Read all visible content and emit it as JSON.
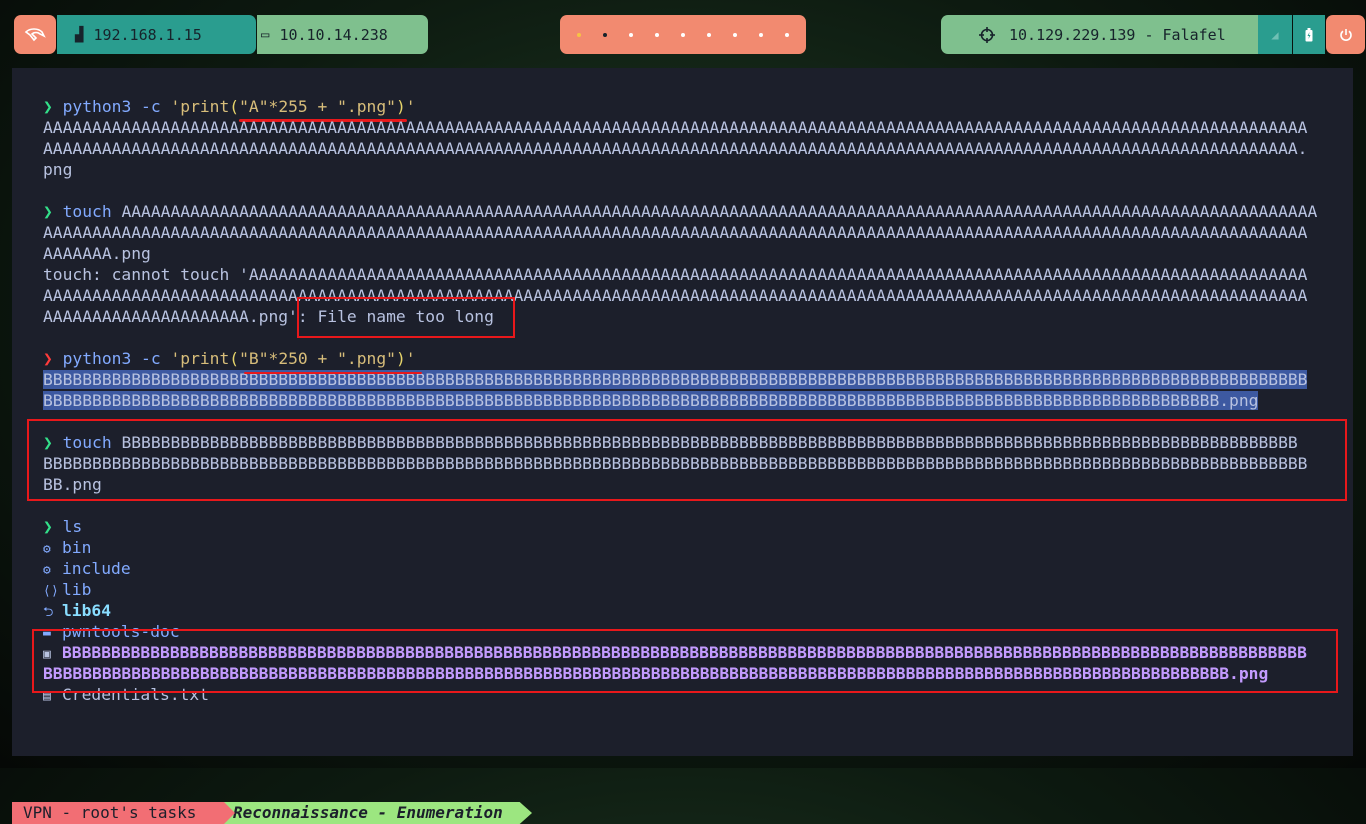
{
  "topbar": {
    "local_ip": "192.168.1.15",
    "vpn_ip": "10.10.14.238",
    "target": "10.129.229.139 - Falafel",
    "workspaces": [
      "urgent",
      "active",
      "",
      "",
      "",
      "",
      "",
      "",
      ""
    ]
  },
  "terminal": {
    "l1_prompt": "❯",
    "l1_cmd": "python3",
    "l1_flag": " -c ",
    "l1_str1": "'print",
    "l1_p1": "(",
    "l1_str2": "\"A\"*255 + \".png\"",
    "l1_p2": ")",
    "l1_str3": "'",
    "l2": "AAAAAAAAAAAAAAAAAAAAAAAAAAAAAAAAAAAAAAAAAAAAAAAAAAAAAAAAAAAAAAAAAAAAAAAAAAAAAAAAAAAAAAAAAAAAAAAAAAAAAAAAAAAAAAAAAAAAAAAAAAAAAAAAA",
    "l3": "AAAAAAAAAAAAAAAAAAAAAAAAAAAAAAAAAAAAAAAAAAAAAAAAAAAAAAAAAAAAAAAAAAAAAAAAAAAAAAAAAAAAAAAAAAAAAAAAAAAAAAAAAAAAAAAAAAAAAAAAAAAAAAAA.",
    "l4": "png",
    "l5_prompt": "❯",
    "l5_cmd": "touch",
    "l5_rest": " AAAAAAAAAAAAAAAAAAAAAAAAAAAAAAAAAAAAAAAAAAAAAAAAAAAAAAAAAAAAAAAAAAAAAAAAAAAAAAAAAAAAAAAAAAAAAAAAAAAAAAAAAAAAAAAAAAAAAAAAAA",
    "l6": "AAAAAAAAAAAAAAAAAAAAAAAAAAAAAAAAAAAAAAAAAAAAAAAAAAAAAAAAAAAAAAAAAAAAAAAAAAAAAAAAAAAAAAAAAAAAAAAAAAAAAAAAAAAAAAAAAAAAAAAAAAAAAAAAA",
    "l7": "AAAAAAA.png",
    "l8": "touch: cannot touch 'AAAAAAAAAAAAAAAAAAAAAAAAAAAAAAAAAAAAAAAAAAAAAAAAAAAAAAAAAAAAAAAAAAAAAAAAAAAAAAAAAAAAAAAAAAAAAAAAAAAAAAAAAAAA",
    "l9": "AAAAAAAAAAAAAAAAAAAAAAAAAAAAAAAAAAAAAAAAAAAAAAAAAAAAAAAAAAAAAAAAAAAAAAAAAAAAAAAAAAAAAAAAAAAAAAAAAAAAAAAAAAAAAAAAAAAAAAAAAAAAAAAAA",
    "l10": "AAAAAAAAAAAAAAAAAAAAA.png': File name too long",
    "l11_prompt": "❯",
    "l11_cmd": "python3",
    "l11_flag": " -c ",
    "l11_str1": "'print",
    "l11_p1": "(",
    "l11_str2": "\"B\"*250 + \".png\"",
    "l11_p2": ")",
    "l11_str3": "'",
    "l12": "BBBBBBBBBBBBBBBBBBBBBBBBBBBBBBBBBBBBBBBBBBBBBBBBBBBBBBBBBBBBBBBBBBBBBBBBBBBBBBBBBBBBBBBBBBBBBBBBBBBBBBBBBBBBBBBBBBBBBBBBBBBBBBBBB",
    "l13": "BBBBBBBBBBBBBBBBBBBBBBBBBBBBBBBBBBBBBBBBBBBBBBBBBBBBBBBBBBBBBBBBBBBBBBBBBBBBBBBBBBBBBBBBBBBBBBBBBBBBBBBBBBBBBBBBBBBBBBBB.png",
    "l14_prompt": "❯",
    "l14_cmd": "touch",
    "l14_rest": " BBBBBBBBBBBBBBBBBBBBBBBBBBBBBBBBBBBBBBBBBBBBBBBBBBBBBBBBBBBBBBBBBBBBBBBBBBBBBBBBBBBBBBBBBBBBBBBBBBBBBBBBBBBBBBBBBBBBBBBB",
    "l15": "BBBBBBBBBBBBBBBBBBBBBBBBBBBBBBBBBBBBBBBBBBBBBBBBBBBBBBBBBBBBBBBBBBBBBBBBBBBBBBBBBBBBBBBBBBBBBBBBBBBBBBBBBBBBBBBBBBBBBBBBBBBBBBBBB",
    "l16": "BB.png",
    "l17_prompt": "❯",
    "l17_cmd": "ls",
    "ls_bin": "bin",
    "ls_include": "include",
    "ls_lib": "lib",
    "ls_lib64": "lib64",
    "ls_pwntools": "pwntools-doc",
    "ls_png1": "BBBBBBBBBBBBBBBBBBBBBBBBBBBBBBBBBBBBBBBBBBBBBBBBBBBBBBBBBBBBBBBBBBBBBBBBBBBBBBBBBBBBBBBBBBBBBBBBBBBBBBBBBBBBBBBBBBBBBBBBBBBBBBB",
    "ls_png2": "BBBBBBBBBBBBBBBBBBBBBBBBBBBBBBBBBBBBBBBBBBBBBBBBBBBBBBBBBBBBBBBBBBBBBBBBBBBBBBBBBBBBBBBBBBBBBBBBBBBBBBBBBBBBBBBBBBBBBBBBB.png",
    "ls_creds": "Credentials.txt"
  },
  "status": {
    "left": "VPN - root's tasks",
    "mid": "Reconnaissance - Enumeration"
  },
  "colors": {
    "accent_red": "#e8181b",
    "terminal_bg": "#1c1f2b"
  }
}
